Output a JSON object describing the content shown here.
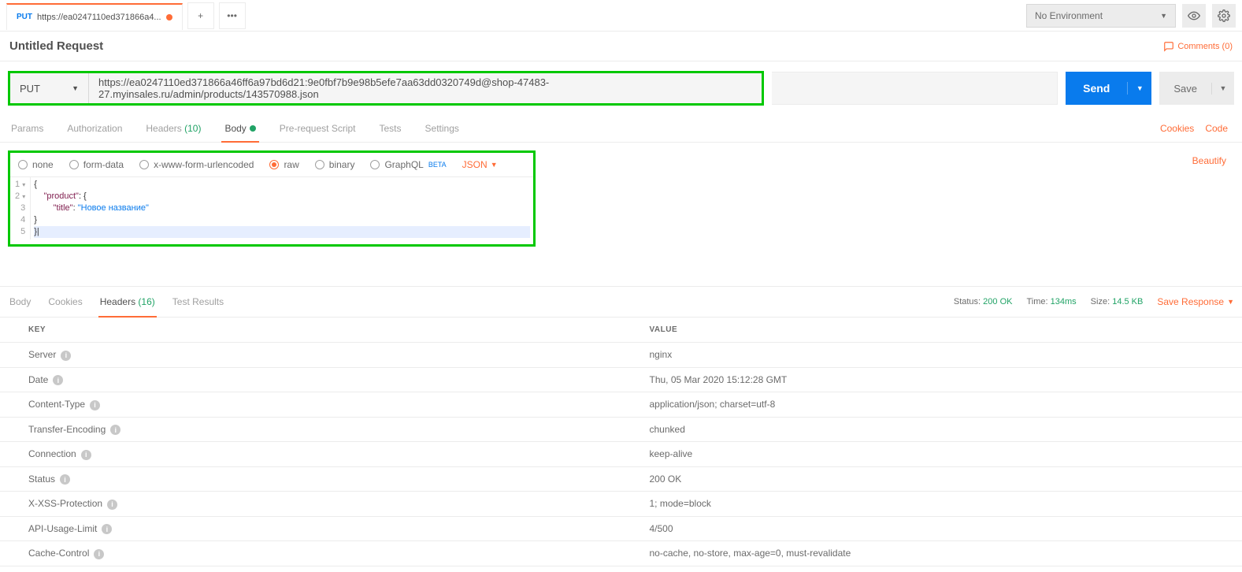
{
  "tab": {
    "method": "PUT",
    "title": "https://ea0247110ed371866a4..."
  },
  "env": {
    "selected": "No Environment"
  },
  "request": {
    "title": "Untitled Request",
    "comments": "Comments (0)"
  },
  "method": {
    "value": "PUT"
  },
  "url": {
    "value": "https://ea0247110ed371866a46ff6a97bd6d21:9e0fbf7b9e98b5efe7aa63dd0320749d@shop-47483-27.myinsales.ru/admin/products/143570988.json"
  },
  "actions": {
    "send": "Send",
    "save": "Save"
  },
  "reqTabs": {
    "params": "Params",
    "auth": "Authorization",
    "headers": "Headers",
    "headers_count": "(10)",
    "body": "Body",
    "prereq": "Pre-request Script",
    "tests": "Tests",
    "settings": "Settings",
    "cookies": "Cookies",
    "code": "Code"
  },
  "radios": {
    "none": "none",
    "formdata": "form-data",
    "xwww": "x-www-form-urlencoded",
    "raw": "raw",
    "binary": "binary",
    "graphql": "GraphQL"
  },
  "beta": "BETA",
  "bodyType": "JSON",
  "beautify": "Beautify",
  "editor": {
    "l1": "{",
    "l2_k": "\"product\"",
    "l2_r": ": {",
    "l3_k": "\"title\"",
    "l3_m": ": ",
    "l3_v": "\"Новое название\"",
    "l4": "    }",
    "l5": "}"
  },
  "respTabs": {
    "body": "Body",
    "cookies": "Cookies",
    "headers": "Headers",
    "headers_count": "(16)",
    "tests": "Test Results"
  },
  "respMeta": {
    "status_l": "Status:",
    "status_v": "200 OK",
    "time_l": "Time:",
    "time_v": "134ms",
    "size_l": "Size:",
    "size_v": "14.5 KB",
    "save": "Save Response"
  },
  "headersTable": {
    "key_h": "KEY",
    "val_h": "VALUE",
    "rows": [
      {
        "k": "Server",
        "v": "nginx"
      },
      {
        "k": "Date",
        "v": "Thu, 05 Mar 2020 15:12:28 GMT"
      },
      {
        "k": "Content-Type",
        "v": "application/json; charset=utf-8"
      },
      {
        "k": "Transfer-Encoding",
        "v": "chunked"
      },
      {
        "k": "Connection",
        "v": "keep-alive"
      },
      {
        "k": "Status",
        "v": "200 OK"
      },
      {
        "k": "X-XSS-Protection",
        "v": "1; mode=block"
      },
      {
        "k": "API-Usage-Limit",
        "v": "4/500"
      },
      {
        "k": "Cache-Control",
        "v": "no-cache, no-store, max-age=0, must-revalidate"
      }
    ]
  }
}
